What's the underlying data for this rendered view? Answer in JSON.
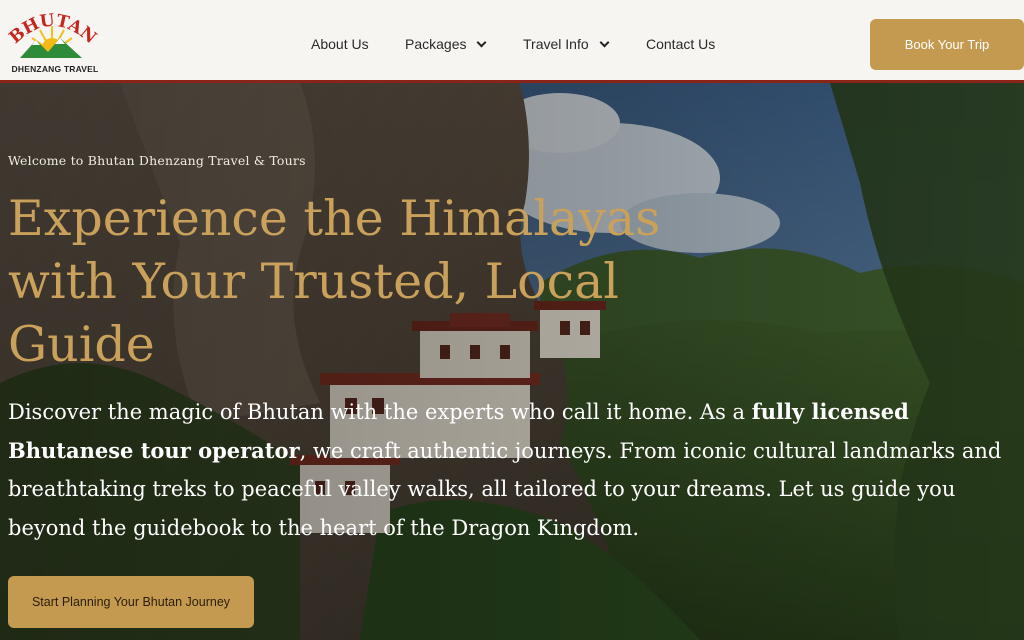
{
  "brand": {
    "logo_text": "BHUTAN",
    "subtitle": "DHENZANG TRAVEL"
  },
  "nav": {
    "items": [
      {
        "label": "About Us",
        "has_dropdown": false
      },
      {
        "label": "Packages",
        "has_dropdown": true
      },
      {
        "label": "Travel Info",
        "has_dropdown": true
      },
      {
        "label": "Contact Us",
        "has_dropdown": false
      }
    ],
    "book_label": "Book Your Trip"
  },
  "hero": {
    "welcome": "Welcome to Bhutan Dhenzang Travel & Tours",
    "headline": "Experience the Himalayas with Your Trusted, Local Guide",
    "desc_part1": "Discover the magic of Bhutan with the experts who call it home. As a ",
    "desc_bold": "fully licensed Bhutanese tour operator",
    "desc_part2": ", we craft authentic journeys. From iconic cultural landmarks and breathtaking treks to peaceful valley walks, all tailored to your dreams. Let us guide you beyond the guidebook to the heart of the Dragon Kingdom.",
    "cta_label": "Start Planning Your Bhutan Journey"
  },
  "colors": {
    "accent_gold": "#c49a50",
    "headline_gold": "#c9a15a",
    "header_border": "#8a2418",
    "header_bg": "#f7f5f1"
  }
}
